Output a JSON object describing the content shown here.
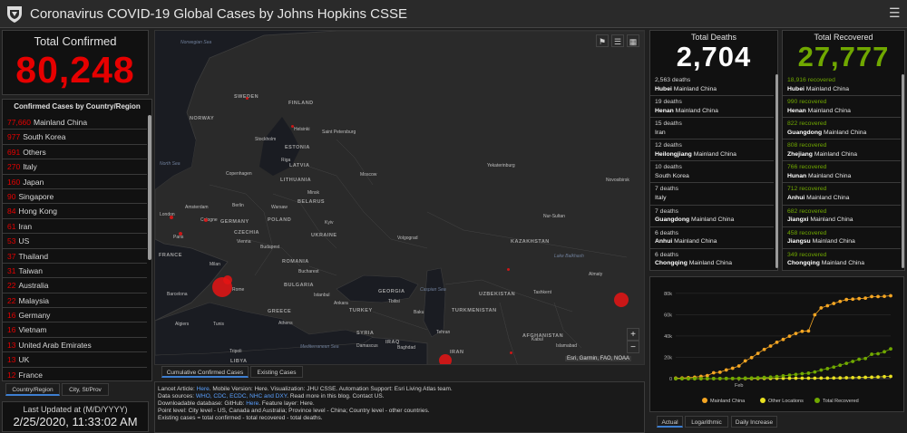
{
  "header": {
    "title": "Coronavirus COVID-19 Global Cases by Johns Hopkins CSSE",
    "menu_icon": "☰"
  },
  "total_confirmed": {
    "label": "Total Confirmed",
    "value": "80,248"
  },
  "country_list": {
    "title": "Confirmed Cases by Country/Region",
    "rows": [
      {
        "count": "77,660",
        "name": "Mainland China"
      },
      {
        "count": "977",
        "name": "South Korea"
      },
      {
        "count": "691",
        "name": "Others"
      },
      {
        "count": "270",
        "name": "Italy"
      },
      {
        "count": "160",
        "name": "Japan"
      },
      {
        "count": "90",
        "name": "Singapore"
      },
      {
        "count": "84",
        "name": "Hong Kong"
      },
      {
        "count": "61",
        "name": "Iran"
      },
      {
        "count": "53",
        "name": "US"
      },
      {
        "count": "37",
        "name": "Thailand"
      },
      {
        "count": "31",
        "name": "Taiwan"
      },
      {
        "count": "22",
        "name": "Australia"
      },
      {
        "count": "22",
        "name": "Malaysia"
      },
      {
        "count": "16",
        "name": "Germany"
      },
      {
        "count": "16",
        "name": "Vietnam"
      },
      {
        "count": "13",
        "name": "United Arab Emirates"
      },
      {
        "count": "13",
        "name": "UK"
      },
      {
        "count": "12",
        "name": "France"
      }
    ],
    "tabs": [
      "Country/Region",
      "City, St/Prov"
    ]
  },
  "last_updated": {
    "label": "Last Updated at (M/D/YYYY)",
    "value": "2/25/2020, 11:33:02 AM"
  },
  "map": {
    "tabs": [
      "Cumulative Confirmed Cases",
      "Existing Cases"
    ],
    "attribution": "Esri, Garmin, FAO, NOAA",
    "zoom_in": "+",
    "zoom_out": "−",
    "tools": [
      "bookmark-icon",
      "list-icon",
      "grid-icon"
    ],
    "labels": {
      "norwegian_sea": "Norwegian Sea",
      "north_sea": "North Sea",
      "mediterranean_sea": "Mediterranean Sea",
      "caspian_sea": "Caspian Sea",
      "lake_balkhash": "Lake Balkhash",
      "sweden": "SWEDEN",
      "finland": "FINLAND",
      "norway": "NORWAY",
      "estonia": "ESTONIA",
      "latvia": "LATVIA",
      "lithuania": "LITHUANIA",
      "belarus": "BELARUS",
      "poland": "POLAND",
      "germany": "GERMANY",
      "czechia": "CZECHIA",
      "ukraine": "UKRAINE",
      "france": "FRANCE",
      "romania": "ROMANIA",
      "bulgaria": "BULGARIA",
      "greece": "GREECE",
      "turkey": "TURKEY",
      "georgia": "GEORGIA",
      "kazakhstan": "KAZAKHSTAN",
      "uzbekistan": "UZBEKISTAN",
      "turkmenistan": "TURKMENISTAN",
      "syria": "SYRIA",
      "iraq": "IRAQ",
      "iran": "IRAN",
      "afghanistan": "AFGHANISTAN",
      "libya": "LIBYA",
      "helsinki": "Helsinki",
      "stockholm": "Stockholm",
      "saint_petersburg": "Saint Petersburg",
      "riga": "Riga",
      "copenhagen": "Copenhagen",
      "minsk": "Minsk",
      "moscow": "Moscow",
      "yekaterinburg": "Yekaterinburg",
      "novosibirsk": "Novosibirsk",
      "london": "London",
      "amsterdam": "Amsterdam",
      "berlin": "Berlin",
      "warsaw": "Warsaw",
      "kyiv": "Kyiv",
      "volgograd": "Volgograd",
      "paris": "Paris",
      "cologne": "Cologne",
      "vienna": "Vienna",
      "budapest": "Budapest",
      "milan": "Milan",
      "barcelona": "Barcelona",
      "rome": "Rome",
      "bucharest": "Bucharest",
      "istanbul": "Istanbul",
      "ankara": "Ankara",
      "tbilisi": "Tbilisi",
      "baku": "Baku",
      "nur_sultan": "Nur-Sultan",
      "almaty": "Almaty",
      "tashkent": "Tashkent",
      "algiers": "Algiers",
      "tunis": "Tunis",
      "athens": "Athens",
      "tripoli": "Tripoli",
      "damascus": "Damascus",
      "baghdad": "Baghdad",
      "tehran": "Tehran",
      "kabul": "Kabul",
      "islamabad": "Islamabad"
    }
  },
  "info": {
    "lines": [
      {
        "text": "Lancet Article: ",
        "link": "Here",
        "rest": ". Mobile Version: Here. Visualization: JHU CSSE. Automation Support: Esri Living Atlas team."
      },
      {
        "text": "Data sources: ",
        "link": "WHO, CDC, ECDC, NHC and DXY",
        "rest": ". Read more in this blog. Contact US."
      },
      {
        "text": "Downloadable database: GitHub: ",
        "link": "Here",
        "rest": ". Feature layer: Here."
      },
      {
        "text": "Point level: City level - US, Canada and Australia; Province level - China; Country level - other countries.",
        "link": "",
        "rest": ""
      },
      {
        "text": "Existing cases = total confirmed - total recovered - total deaths.",
        "link": "",
        "rest": ""
      }
    ]
  },
  "deaths": {
    "label": "Total Deaths",
    "value": "2,704",
    "rows": [
      {
        "count": "2,563 deaths",
        "place": "Hubei",
        "region": "Mainland China"
      },
      {
        "count": "19 deaths",
        "place": "Henan",
        "region": "Mainland China"
      },
      {
        "count": "15 deaths",
        "place": "",
        "region": "Iran"
      },
      {
        "count": "12 deaths",
        "place": "Heilongjiang",
        "region": "Mainland China"
      },
      {
        "count": "10 deaths",
        "place": "",
        "region": "South Korea"
      },
      {
        "count": "7 deaths",
        "place": "",
        "region": "Italy"
      },
      {
        "count": "7 deaths",
        "place": "Guangdong",
        "region": "Mainland China"
      },
      {
        "count": "6 deaths",
        "place": "Anhui",
        "region": "Mainland China"
      },
      {
        "count": "6 deaths",
        "place": "Chongqing",
        "region": "Mainland China"
      }
    ]
  },
  "recovered": {
    "label": "Total Recovered",
    "value": "27,777",
    "rows": [
      {
        "count": "18,916 recovered",
        "place": "Hubei",
        "region": "Mainland China"
      },
      {
        "count": "990 recovered",
        "place": "Henan",
        "region": "Mainland China"
      },
      {
        "count": "822 recovered",
        "place": "Guangdong",
        "region": "Mainland China"
      },
      {
        "count": "808 recovered",
        "place": "Zhejiang",
        "region": "Mainland China"
      },
      {
        "count": "766 recovered",
        "place": "Hunan",
        "region": "Mainland China"
      },
      {
        "count": "712 recovered",
        "place": "Anhui",
        "region": "Mainland China"
      },
      {
        "count": "682 recovered",
        "place": "Jiangxi",
        "region": "Mainland China"
      },
      {
        "count": "458 recovered",
        "place": "Jiangsu",
        "region": "Mainland China"
      },
      {
        "count": "349 recovered",
        "place": "Chongqing",
        "region": "Mainland China"
      }
    ]
  },
  "chart_data": {
    "type": "line",
    "title": "",
    "xlabel": "",
    "ylabel": "",
    "x": [
      1,
      2,
      3,
      4,
      5,
      6,
      7,
      8,
      9,
      10,
      11,
      12,
      13,
      14,
      15,
      16,
      17,
      18,
      19,
      20,
      21,
      22,
      23,
      24,
      25,
      26,
      27,
      28,
      29,
      30,
      31,
      32,
      33,
      34,
      35
    ],
    "x_tick_labels": [
      {
        "x": 11,
        "label": "Feb"
      }
    ],
    "y_tick_labels": [
      "0",
      "20k",
      "40k",
      "60k",
      "80k"
    ],
    "ylim": [
      0,
      85000
    ],
    "grid": true,
    "legend_position": "bottom",
    "series": [
      {
        "name": "Mainland China",
        "color": "#f5a623",
        "values": [
          548,
          643,
          920,
          1406,
          2075,
          2877,
          5509,
          6087,
          8141,
          9802,
          11891,
          16630,
          19716,
          23707,
          27440,
          30587,
          34110,
          36814,
          39829,
          42354,
          44386,
          44759,
          59895,
          66358,
          68413,
          70513,
          72434,
          74211,
          74619,
          75077,
          75550,
          77001,
          77022,
          77241,
          77754
        ]
      },
      {
        "name": "Other Locations",
        "color": "#e8e020",
        "values": [
          7,
          11,
          21,
          28,
          43,
          50,
          59,
          71,
          82,
          105,
          120,
          147,
          159,
          180,
          206,
          236,
          271,
          300,
          330,
          388,
          418,
          437,
          450,
          507,
          524,
          593,
          683,
          804,
          926,
          1073,
          1206,
          1340,
          1586,
          1936,
          2125
        ]
      },
      {
        "name": "Total Recovered",
        "color": "#70a800",
        "values": [
          28,
          30,
          36,
          39,
          52,
          61,
          107,
          126,
          143,
          222,
          284,
          472,
          623,
          852,
          1124,
          1487,
          2011,
          2616,
          3244,
          3946,
          4683,
          5150,
          6295,
          8058,
          9395,
          10865,
          12583,
          14352,
          16121,
          18177,
          18890,
          22886,
          23394,
          25227,
          27905
        ]
      }
    ]
  },
  "chart_tabs": [
    "Actual",
    "Logarithmic",
    "Daily Increase"
  ]
}
